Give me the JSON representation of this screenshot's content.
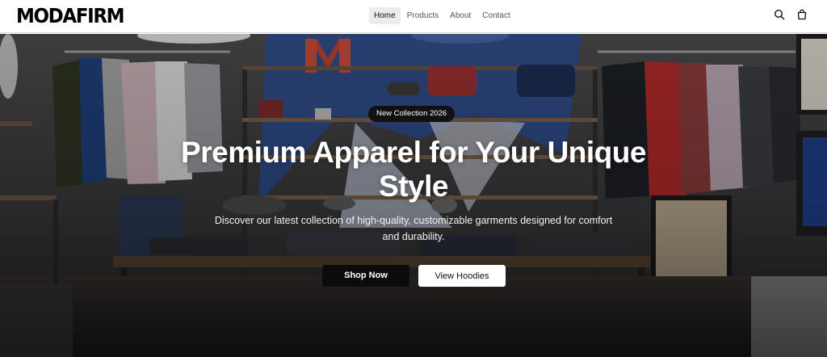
{
  "brand": {
    "logo": "MODAFIRM"
  },
  "nav": {
    "items": [
      {
        "label": "Home",
        "active": true
      },
      {
        "label": "Products",
        "active": false
      },
      {
        "label": "About",
        "active": false
      },
      {
        "label": "Contact",
        "active": false
      }
    ]
  },
  "header_actions": {
    "icons": [
      "search-icon",
      "shopping-bag-icon"
    ]
  },
  "hero": {
    "badge": "New Collection 2026",
    "title": "Premium Apparel for Your Unique Style",
    "subtitle": "Discover our latest collection of high-quality, customizable garments designed for comfort and durability.",
    "primary_button": "Shop Now",
    "secondary_button": "View Hoodies"
  },
  "colors": {
    "header_bg": "#ffffff",
    "primary_button_bg": "#0b0b0b",
    "secondary_button_bg": "#ffffff",
    "hero_text": "#ffffff"
  }
}
